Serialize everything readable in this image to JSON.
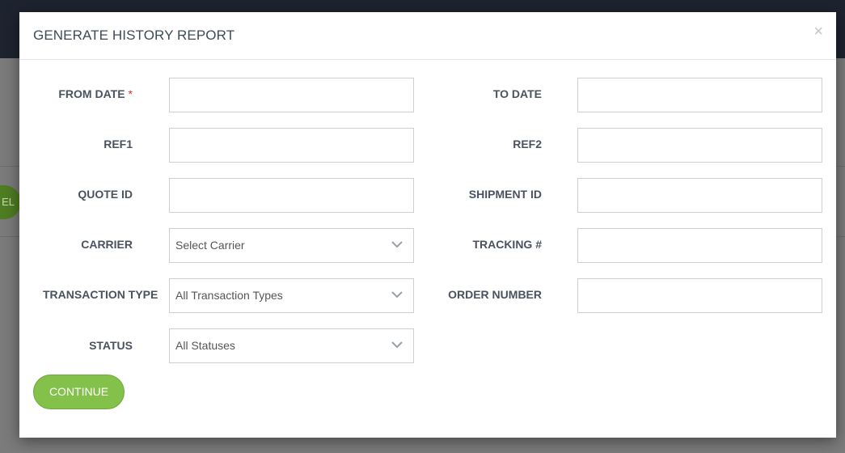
{
  "background": {
    "button_fragment": "EL"
  },
  "modal": {
    "title": "GENERATE HISTORY REPORT",
    "close_glyph": "×",
    "fields": {
      "from_date": {
        "label": "FROM DATE",
        "required_mark": "*",
        "value": ""
      },
      "to_date": {
        "label": "TO DATE",
        "value": ""
      },
      "ref1": {
        "label": "REF1",
        "value": ""
      },
      "ref2": {
        "label": "REF2",
        "value": ""
      },
      "quote_id": {
        "label": "QUOTE ID",
        "value": ""
      },
      "shipment_id": {
        "label": "SHIPMENT ID",
        "value": ""
      },
      "carrier": {
        "label": "CARRIER",
        "selected": "Select Carrier"
      },
      "tracking": {
        "label": "TRACKING #",
        "value": ""
      },
      "transaction_type": {
        "label": "TRANSACTION TYPE",
        "selected": "All Transaction Types"
      },
      "order_number": {
        "label": "ORDER NUMBER",
        "value": ""
      },
      "status": {
        "label": "STATUS",
        "selected": "All Statuses"
      }
    },
    "continue_label": "CONTINUE"
  },
  "colors": {
    "accent_green": "#84c14a",
    "required_red": "#e0302b",
    "label_text": "#4a5260"
  },
  "icons": {
    "close": "close-icon",
    "dropdown": "chevron-down-icon"
  }
}
